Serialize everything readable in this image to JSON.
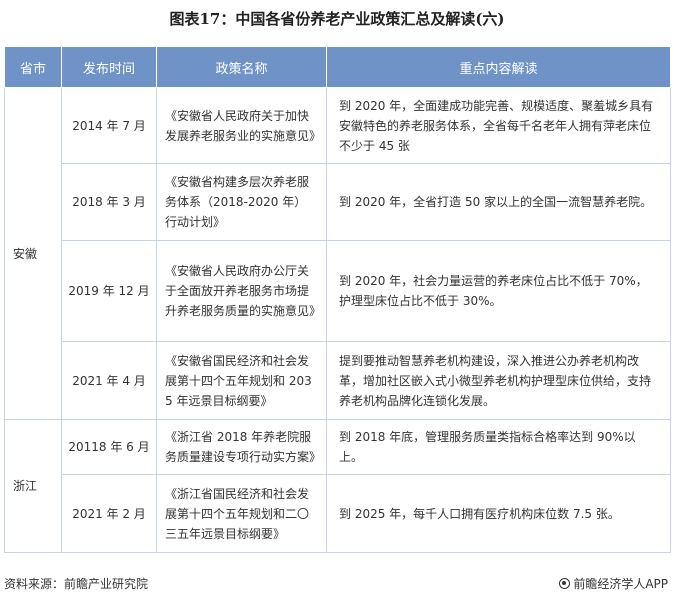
{
  "title": "图表17：中国各省份养老产业政策汇总及解读(六)",
  "table": {
    "headers": [
      "省市",
      "发布时间",
      "政策名称",
      "重点内容解读"
    ],
    "groups": [
      {
        "province": "安徽",
        "rows": [
          {
            "date": "2014 年 7 月",
            "name": "《安徽省人民政府关于加快发展养老服务业的实施意见》",
            "key": "到 2020 年，全面建成功能完善、规模适度、聚羞城乡具有安徽特色的养老服务体系，全省每千名老年人拥有萍老床位不少于 45 张"
          },
          {
            "date": "2018 年 3 月",
            "name": "《安徽省构建多层次养老服务体系（2018-2020 年）行动计划》",
            "key": "到 2020 年，全省打造 50 家以上的全国一流智慧养老院。"
          },
          {
            "date": "2019 年 12 月",
            "name": "《安徽省人民政府办公厅关于全面放开养老服务市场提升养老服务质量的实施意见》",
            "key": "到 2020 年，社会力量运营的养老床位占比不低于 70%，护理型床位占比不低于 30%。"
          },
          {
            "date": "2021 年 4 月",
            "name": "《安徽省国民经济和社会发展第十四个五年规划和 2035 年远景目标纲要》",
            "key": "提到要推动智慧养老机构建设，深入推进公办养老机构改革，增加社区嵌入式小微型养老机构护理型床位供给，支持养老机构品牌化连锁化发展。"
          }
        ]
      },
      {
        "province": "浙江",
        "rows": [
          {
            "date": "20118 年 6 月",
            "name": "《浙江省 2018 年养老院服务质量建设专项行动实方案》",
            "key": "到 2018 年底，管理服务质量类指标合格率达到 90%以上。"
          },
          {
            "date": "2021 年 2 月",
            "name": "《浙江省国民经济和社会发展第十四个五年规划和二〇三五年远景目标纲要》",
            "key": "到 2025 年，每千人口拥有医疗机构床位数 7.5 张。"
          }
        ]
      }
    ]
  },
  "footer": {
    "source": "资料来源：前瞻产业研究院",
    "brand": "前瞻经济学人APP"
  },
  "colors": {
    "header_bg": "#6f93c7",
    "border": "#c7d3e3"
  }
}
